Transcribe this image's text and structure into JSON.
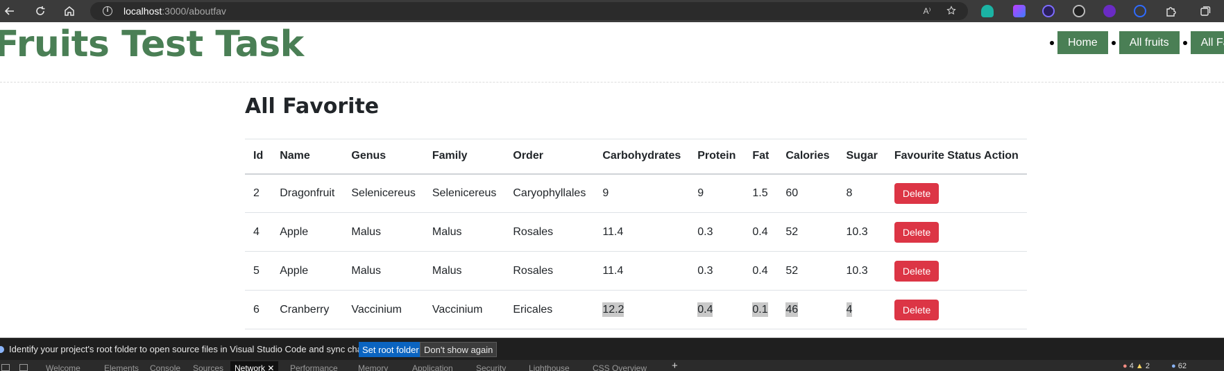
{
  "browser": {
    "url_host": "localhost",
    "url_path": ":3000/aboutfav",
    "read_aloud_label": "A⁾"
  },
  "header": {
    "title": "Fruits Test Task",
    "nav": [
      "Home",
      "All fruits",
      "All Fa"
    ]
  },
  "main": {
    "heading": "All Favorite",
    "table": {
      "columns": [
        "Id",
        "Name",
        "Genus",
        "Family",
        "Order",
        "Carbohydrates",
        "Protein",
        "Fat",
        "Calories",
        "Sugar",
        "Favourite Status Action"
      ],
      "rows": [
        {
          "id": "2",
          "name": "Dragonfruit",
          "genus": "Selenicereus",
          "family": "Selenicereus",
          "order": "Caryophyllales",
          "carbohydrates": "9",
          "protein": "9",
          "fat": "1.5",
          "calories": "60",
          "sugar": "8",
          "action": "Delete"
        },
        {
          "id": "4",
          "name": "Apple",
          "genus": "Malus",
          "family": "Malus",
          "order": "Rosales",
          "carbohydrates": "11.4",
          "protein": "0.3",
          "fat": "0.4",
          "calories": "52",
          "sugar": "10.3",
          "action": "Delete"
        },
        {
          "id": "5",
          "name": "Apple",
          "genus": "Malus",
          "family": "Malus",
          "order": "Rosales",
          "carbohydrates": "11.4",
          "protein": "0.3",
          "fat": "0.4",
          "calories": "52",
          "sugar": "10.3",
          "action": "Delete"
        },
        {
          "id": "6",
          "name": "Cranberry",
          "genus": "Vaccinium",
          "family": "Vaccinium",
          "order": "Ericales",
          "carbohydrates": "12.2",
          "protein": "0.4",
          "fat": "0.1",
          "calories": "46",
          "sugar": "4",
          "action": "Delete"
        }
      ]
    }
  },
  "devtools": {
    "notice": "Identify your project's root folder to open source files in Visual Studio Code and sync changes.",
    "set_root_label": "Set root folder",
    "dismiss_label": "Don't show again",
    "tabs": [
      "Welcome",
      "Elements",
      "Console",
      "Sources",
      "Network",
      "Performance",
      "Memory",
      "Application",
      "Security",
      "Lighthouse",
      "CSS Overview"
    ],
    "active_tab": "Network",
    "errors": "4",
    "warnings": "2",
    "issues": "62"
  },
  "colors": {
    "brand_green": "#4a7f55",
    "delete_red": "#dc3545",
    "devtools_blue": "#0b64c0"
  }
}
